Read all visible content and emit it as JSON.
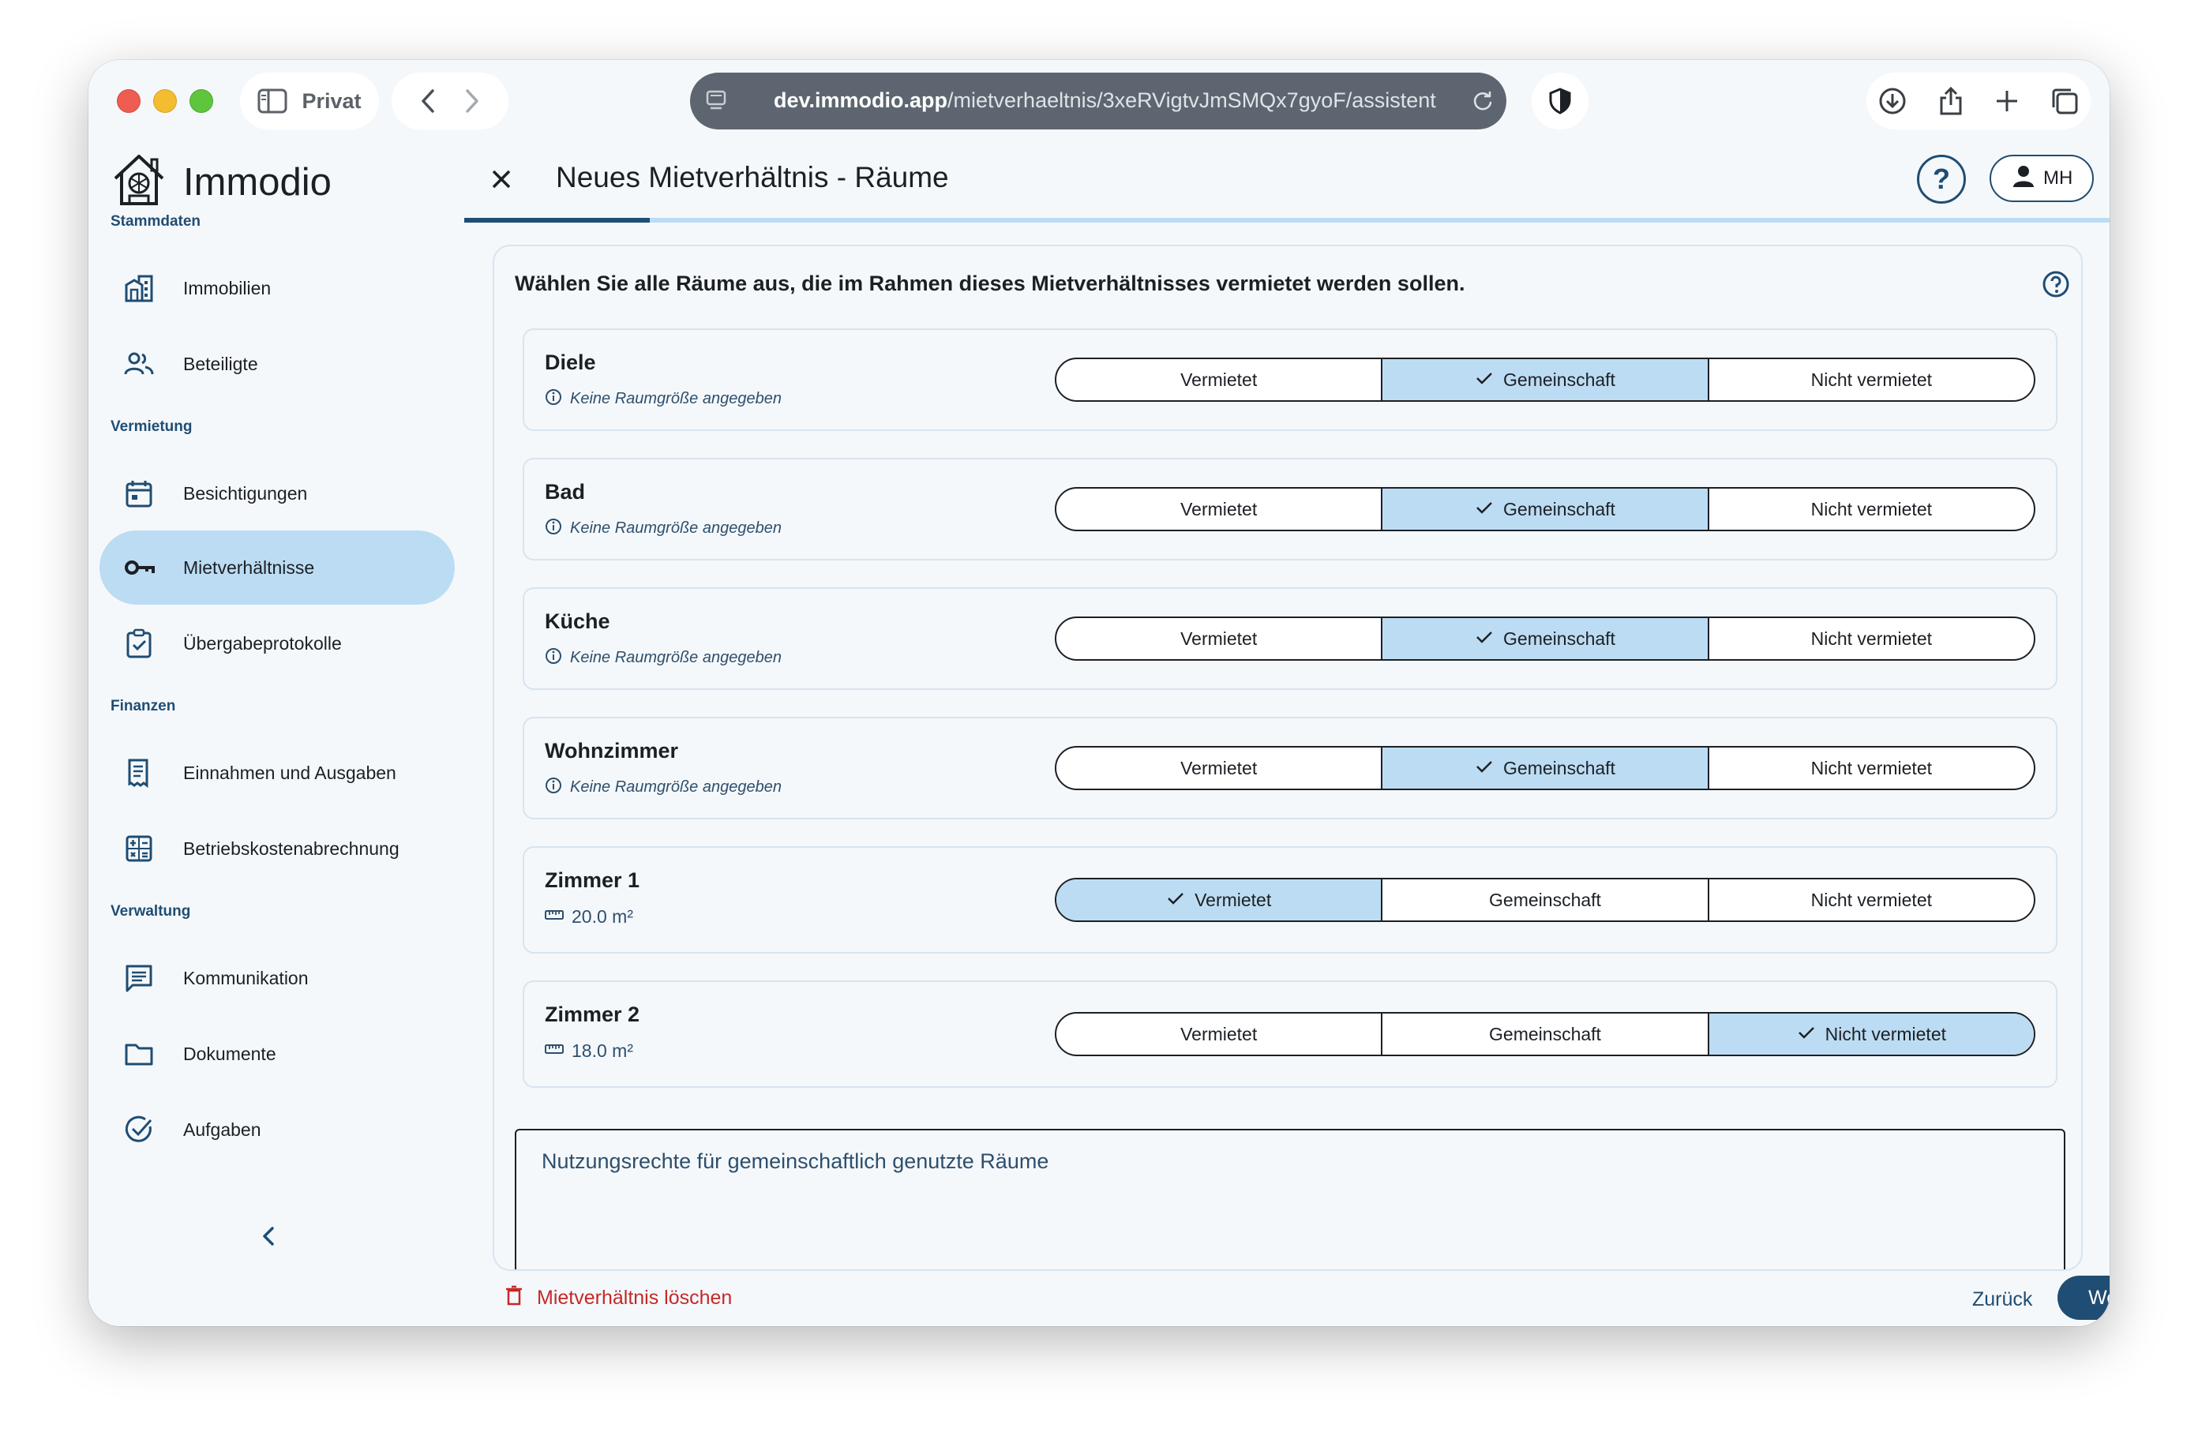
{
  "browser": {
    "private_label": "Privat",
    "url_host": "dev.immodio.app",
    "url_path": "/mietverhaeltnis/3xeRVigtvJmSMQx7gyoF/assistent"
  },
  "sidebar": {
    "app_name": "Immodio",
    "sections": {
      "stammdaten": "Stammdaten",
      "vermietung": "Vermietung",
      "finanzen": "Finanzen",
      "verwaltung": "Verwaltung"
    },
    "items": {
      "immobilien": "Immobilien",
      "beteiligte": "Beteiligte",
      "besichtigungen": "Besichtigungen",
      "mietverhaeltnisse": "Mietverhältnisse",
      "uebergabeprotokolle": "Übergabeprotokolle",
      "einnahmen": "Einnahmen und Ausgaben",
      "betriebskosten": "Betriebskostenabrechnung",
      "kommunikation": "Kommunikation",
      "dokumente": "Dokumente",
      "aufgaben": "Aufgaben"
    },
    "active_item": "Mietverhältnisse"
  },
  "header": {
    "title": "Neues Mietverhältnis - Räume",
    "help_label": "?",
    "user_initials": "MH",
    "progress": 0.113
  },
  "card": {
    "question": "Wählen Sie alle Räume aus, die im Rahmen dieses Mietverhältnisses vermietet werden sollen.",
    "options": {
      "rented": "Vermietet",
      "shared": "Gemeinschaft",
      "not_rented": "Nicht vermietet"
    },
    "rooms": [
      {
        "name": "Diele",
        "size_text": "Keine Raumgröße angegeben",
        "selected": "Gemeinschaft"
      },
      {
        "name": "Bad",
        "size_text": "Keine Raumgröße angegeben",
        "selected": "Gemeinschaft"
      },
      {
        "name": "Küche",
        "size_text": "Keine Raumgröße angegeben",
        "selected": "Gemeinschaft"
      },
      {
        "name": "Wohnzimmer",
        "size_text": "Keine Raumgröße angegeben",
        "selected": "Gemeinschaft"
      },
      {
        "name": "Zimmer 1",
        "size_text": "20.0 m²",
        "selected": "Vermietet"
      },
      {
        "name": "Zimmer 2",
        "size_text": "18.0 m²",
        "selected": "Nicht vermietet"
      }
    ],
    "usage_rights_placeholder": "Nutzungsrechte für gemeinschaftlich genutzte Räume"
  },
  "footer": {
    "delete_label": "Mietverhältnis löschen",
    "back_label": "Zurück",
    "next_label": "Weiter"
  },
  "colors": {
    "primary": "#1f4d73",
    "selected_bg": "#bcdcf3",
    "danger": "#c62828",
    "background": "#f5f8fb"
  }
}
